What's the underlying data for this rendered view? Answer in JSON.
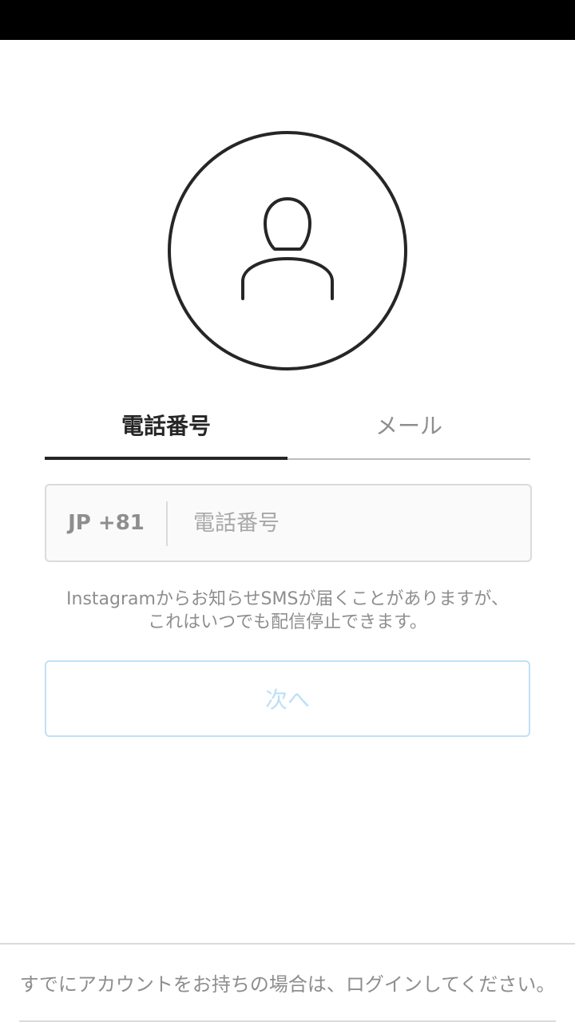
{
  "tabs": {
    "phone_label": "電話番号",
    "email_label": "メール",
    "active": "phone"
  },
  "phone_field": {
    "country_code": "JP +81",
    "placeholder": "電話番号",
    "value": ""
  },
  "info": {
    "line1": "Instagramからお知らせSMSが届くことがありますが、",
    "line2": "これはいつでも配信停止できます。"
  },
  "next_button": {
    "label": "次へ"
  },
  "footer": {
    "login_prompt": "すでにアカウントをお持ちの場合は、ログインしてください。"
  },
  "colors": {
    "text_primary": "#262626",
    "text_secondary": "#8e8e8e",
    "button_disabled_text": "#bde0f5",
    "button_disabled_border": "#bfe1f5",
    "field_background": "#fafafa",
    "divider": "#dbdbdb"
  },
  "icons": {
    "avatar": "user-profile-icon"
  }
}
